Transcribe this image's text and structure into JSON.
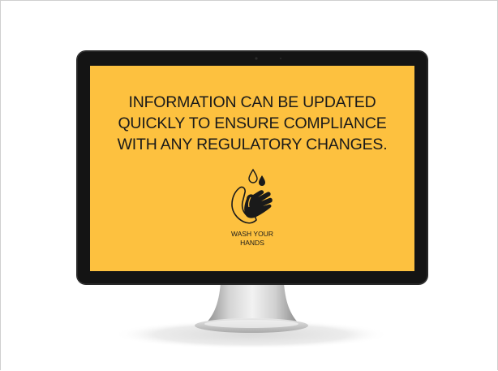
{
  "screen": {
    "headline": "INFORMATION CAN BE UPDATED\nQUICKLY TO ENSURE COMPLIANCE\nWITH ANY REGULATORY CHANGES.",
    "caption": "WASH YOUR\nHANDS",
    "icon": "hand-washing-icon"
  },
  "colors": {
    "screen_background": "#fdc13f",
    "bezel": "#141414",
    "text": "#1a1a1a",
    "stand": "#c4c4c4",
    "shadow": "#e6e6e6"
  }
}
